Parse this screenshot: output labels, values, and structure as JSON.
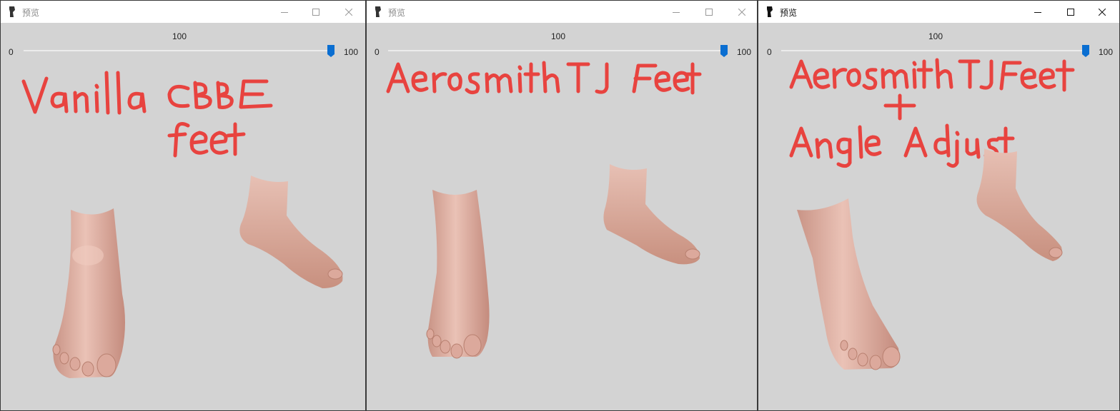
{
  "colors": {
    "viewport_bg": "#d3d3d3",
    "titlebar_bg": "#ffffff",
    "slider_accent": "#0a6ed1",
    "annotation_red": "#e8433f",
    "skin": "#e4b9ad"
  },
  "windows": [
    {
      "title": "预览",
      "icon": "app-icon",
      "controls": [
        "minimize-icon",
        "maximize-icon",
        "close-icon"
      ],
      "slider": {
        "value_label": "100",
        "min_label": "0",
        "max_label": "100",
        "value": 100,
        "min": 0,
        "max": 100
      },
      "annotation": [
        "Vanilla CBBE",
        "feet"
      ]
    },
    {
      "title": "预览",
      "icon": "app-icon",
      "controls": [
        "minimize-icon",
        "maximize-icon",
        "close-icon"
      ],
      "slider": {
        "value_label": "100",
        "min_label": "0",
        "max_label": "100",
        "value": 100,
        "min": 0,
        "max": 100
      },
      "annotation": [
        "Aerosmith TJ Feet"
      ]
    },
    {
      "title": "预览",
      "icon": "app-icon",
      "controls": [
        "minimize-icon",
        "maximize-icon",
        "close-icon"
      ],
      "slider": {
        "value_label": "100",
        "min_label": "0",
        "max_label": "100",
        "value": 100,
        "min": 0,
        "max": 100
      },
      "annotation": [
        "Aerosmith TJ Feet",
        "+",
        "Angle Adjust"
      ]
    }
  ]
}
